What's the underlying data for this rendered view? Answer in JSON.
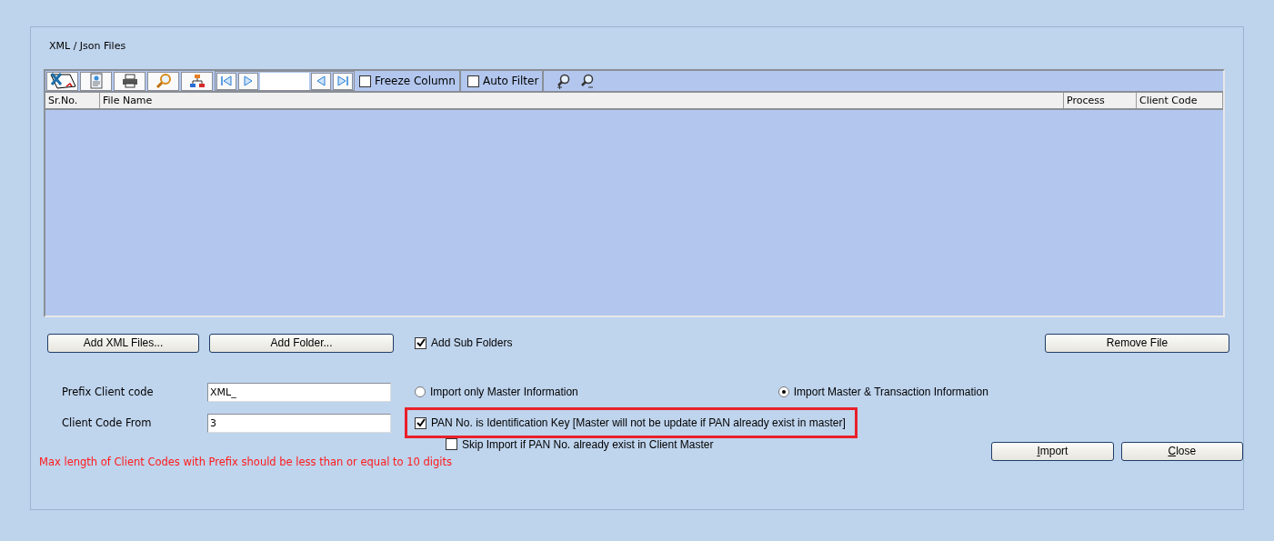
{
  "panel": {
    "title": "XML / Json Files"
  },
  "toolbar": {
    "checkboxes": [
      {
        "label": "Freeze Column",
        "checked": false
      },
      {
        "label": "Auto Filter",
        "checked": false
      }
    ]
  },
  "table": {
    "columns": [
      "Sr.No.",
      "File Name",
      "Process",
      "Client Code"
    ]
  },
  "file_buttons": [
    "Add XML Files...",
    "Add Folder..."
  ],
  "add_sub_folders": {
    "label": "Add Sub Folders",
    "checked": true
  },
  "remove_button": "Remove File",
  "fields": [
    {
      "label": "Prefix Client code",
      "value": "XML_"
    },
    {
      "label": "Client Code From",
      "value": "3"
    }
  ],
  "import_options": [
    {
      "label": "Import only Master Information",
      "selected": false
    },
    {
      "label": "Import Master & Transaction Information",
      "selected": true
    }
  ],
  "pan_key": {
    "label": "PAN No. is Identification Key [Master will not be update if PAN already exist in master]",
    "checked": true,
    "highlighted": true
  },
  "skip_import": {
    "label": "Skip Import if PAN No. already exist in Client Master",
    "checked": false
  },
  "actions": [
    {
      "accelerator": "I",
      "rest": "mport"
    },
    {
      "accelerator": "C",
      "rest": "lose"
    }
  ],
  "note": "Max length of Client Codes with Prefix should be less than or equal to 10 digits"
}
